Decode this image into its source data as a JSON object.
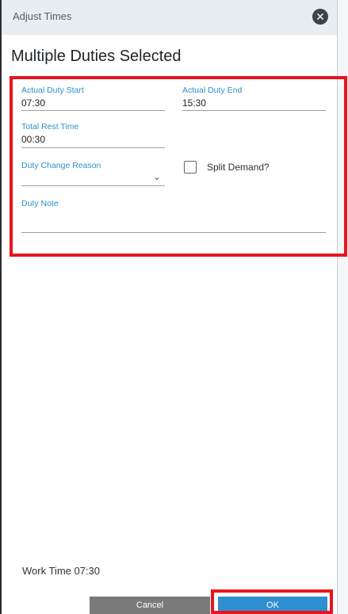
{
  "window": {
    "title": "Adjust Times",
    "close_icon": "close-icon"
  },
  "heading": "Multiple Duties Selected",
  "fields": {
    "actual_duty_start": {
      "label": "Actual Duty Start",
      "value": "07:30"
    },
    "actual_duty_end": {
      "label": "Actual Duty End",
      "value": "15:30"
    },
    "total_rest_time": {
      "label": "Total Rest Time",
      "value": "00:30"
    },
    "duty_change_reason": {
      "label": "Duty Change Reason",
      "value": ""
    },
    "split_demand": {
      "label": "Split Demand?",
      "checked": false
    },
    "duty_note": {
      "label": "Duty Note",
      "value": ""
    }
  },
  "footer": {
    "work_time": "Work Time 07:30",
    "cancel_label": "Cancel",
    "ok_label": "OK"
  },
  "colors": {
    "accent": "#2e90c9",
    "highlight": "#e8151c",
    "ok_button": "#2f8ecf",
    "cancel_button": "#7a7a7a"
  }
}
